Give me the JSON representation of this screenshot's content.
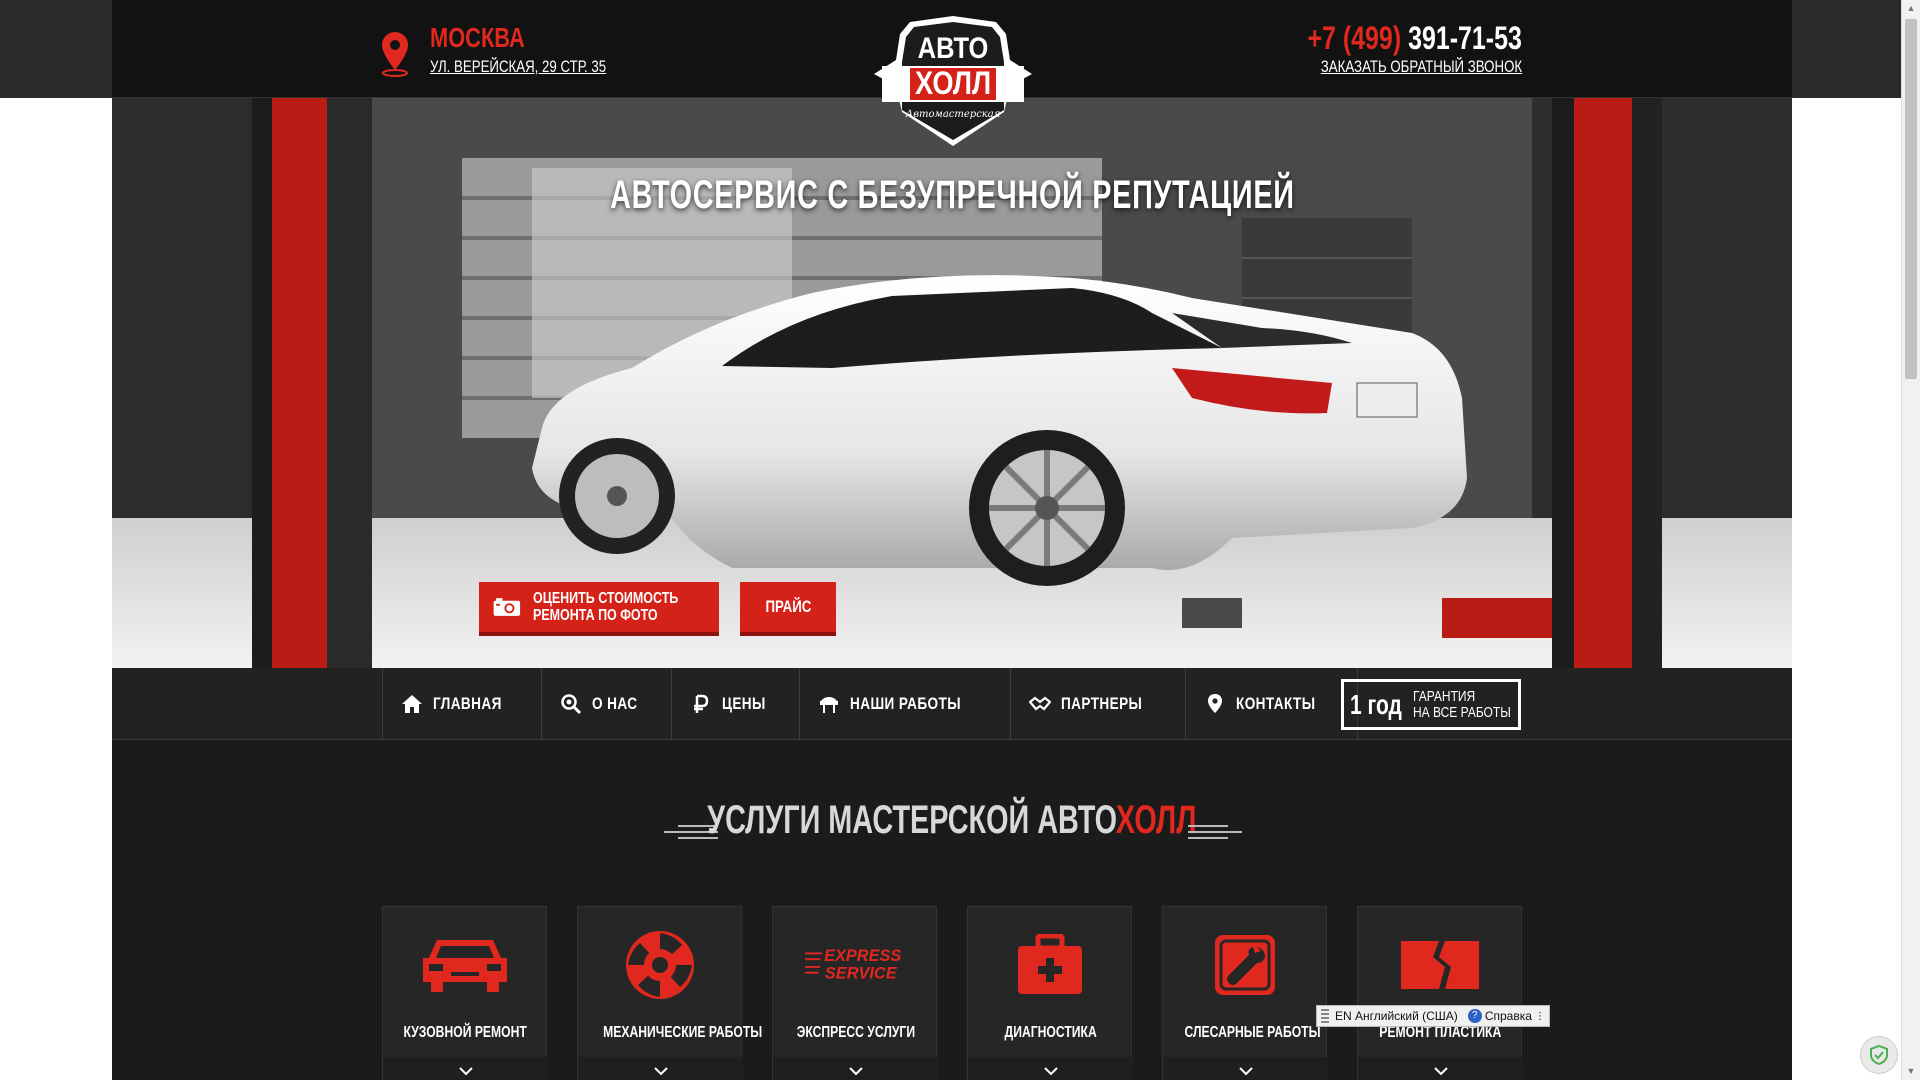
{
  "header": {
    "city": "МОСКВА",
    "address": "УЛ. ВЕРЕЙСКАЯ, 29 СТР. 35",
    "phone_code": "+7 (499)",
    "phone_number": "391-71-53",
    "callback_label": "ЗАКАЗАТЬ ОБРАТНЫЙ ЗВОНОК",
    "logo": {
      "top": "АВТО",
      "main": "ХОЛЛ",
      "sub": "Автомастерская"
    }
  },
  "hero": {
    "title": "АВТОСЕРВИС С БЕЗУПРЕЧНОЙ РЕПУТАЦИЕЙ",
    "photo_button_line1": "ОЦЕНИТЬ СТОИМОСТЬ",
    "photo_button_line2": "РЕМОНТА ПО ФОТО",
    "price_button": "ПРАЙС"
  },
  "nav": {
    "items": [
      {
        "label": "ГЛАВНАЯ",
        "icon": "home-icon"
      },
      {
        "label": "О НАС",
        "icon": "search-gear-icon"
      },
      {
        "label": "ЦЕНЫ",
        "icon": "ruble-icon"
      },
      {
        "label": "НАШИ РАБОТЫ",
        "icon": "car-lift-icon"
      },
      {
        "label": "ПАРТНЕРЫ",
        "icon": "handshake-icon"
      },
      {
        "label": "КОНТАКТЫ",
        "icon": "map-pin-icon"
      }
    ],
    "guarantee_big": "1 год",
    "guarantee_line1": "ГАРАНТИЯ",
    "guarantee_line2": "НА ВСЕ РАБОТЫ"
  },
  "services": {
    "title_prefix": "УСЛУГИ МАСТЕРСКОЙ ",
    "title_brand_a": "АВТО",
    "title_brand_b": "ХОЛЛ",
    "items": [
      {
        "label": "КУЗОВНОЙ РЕМОНТ",
        "icon": "car-body-icon"
      },
      {
        "label": "МЕХАНИЧЕСКИЕ РАБОТЫ",
        "icon": "gear-saw-icon"
      },
      {
        "label": "ЭКСПРЕСС УСЛУГИ",
        "icon": "express-service-icon"
      },
      {
        "label": "ДИАГНОСТИКА",
        "icon": "first-aid-kit-icon"
      },
      {
        "label": "СЛЕСАРНЫЕ РАБОТЫ",
        "icon": "wrench-icon"
      },
      {
        "label": "РЕМОНТ ПЛАСТИКА",
        "icon": "broken-panel-icon"
      }
    ],
    "express_line1": "EXPRESS",
    "express_line2": "SERVICE"
  },
  "os": {
    "lang": "EN Английский (США)",
    "help": "Справка",
    "help_icon": "?"
  },
  "colors": {
    "accent": "#e0281e",
    "dark": "#1b1b1b",
    "header": "#121212"
  }
}
